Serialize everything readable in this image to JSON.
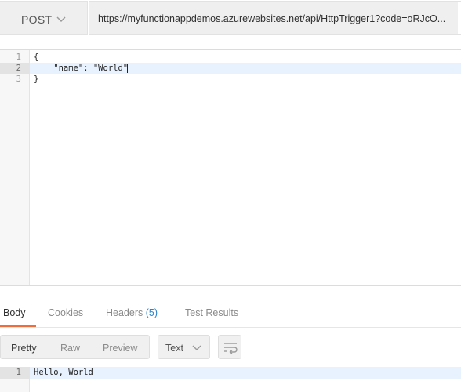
{
  "request": {
    "method": "POST",
    "url": "https://myfunctionappdemos.azurewebsites.net/api/HttpTrigger1?code=oRJcO..."
  },
  "editor": {
    "lines": [
      {
        "number": "1",
        "text": "{"
      },
      {
        "number": "2",
        "text": "    \"name\": \"World\""
      },
      {
        "number": "3",
        "text": "}"
      }
    ]
  },
  "response": {
    "tabs": {
      "body": "Body",
      "cookies": "Cookies",
      "headers": "Headers",
      "headers_count": "(5)",
      "test_results": "Test Results"
    },
    "view_modes": [
      "Pretty",
      "Raw",
      "Preview"
    ],
    "format": "Text",
    "line_number": "1",
    "body_text": "Hello, World"
  },
  "colors": {
    "accent": "#f26b3a",
    "count": "#2a82c9",
    "active_line": "#e8f2fe"
  },
  "icons": {
    "method_dropdown": "chevron-down-icon",
    "format_dropdown": "chevron-down-icon",
    "wrap": "wrap-lines-icon"
  }
}
